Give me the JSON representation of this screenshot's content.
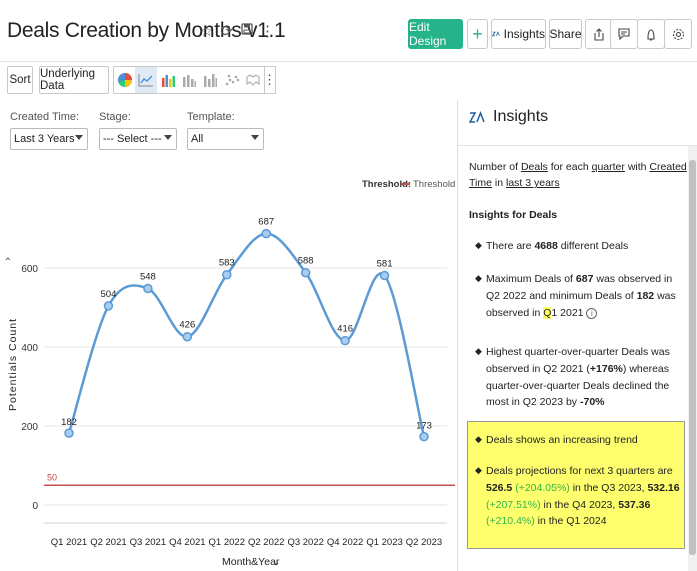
{
  "header": {
    "title": "Deals Creation by Months v1.1",
    "edit_design": "Edit Design",
    "plus": "+",
    "insights": "Insights",
    "share": "Share"
  },
  "toolbar": {
    "sort": "Sort",
    "underlying_data": "Underlying Data"
  },
  "filters": {
    "created_time_label": "Created Time:",
    "created_time_value": "Last 3 Years",
    "stage_label": "Stage:",
    "stage_value": "--- Select ---",
    "template_label": "Template:",
    "template_value": "All"
  },
  "colors": {
    "accent": "#25b38a",
    "series": "#5b9bd5",
    "threshold": "#c0504d",
    "highlight": "#ffff6e"
  },
  "chart_data": {
    "type": "line",
    "categories": [
      "Q1 2021",
      "Q2 2021",
      "Q3 2021",
      "Q4 2021",
      "Q1 2022",
      "Q2 2022",
      "Q3 2022",
      "Q4 2022",
      "Q1 2023",
      "Q2 2023"
    ],
    "values": [
      182,
      504,
      548,
      426,
      583,
      687,
      588,
      416,
      581,
      173
    ],
    "xlabel": "Month&Year",
    "ylabel": "Potentials Count",
    "ylim": [
      0,
      700
    ],
    "yticks": [
      0,
      200,
      400,
      600
    ],
    "threshold": 50,
    "threshold_label": "50",
    "legend_title": "Threshold:",
    "legend_item": "Threshold",
    "legend_position": "top-right",
    "grid": true,
    "smooth": true
  },
  "insights": {
    "title": "Insights",
    "summary_1": "Number of",
    "summary_deals": "Deals",
    "summary_2": "for each",
    "summary_quarter": "quarter",
    "summary_3": "with",
    "summary_created_time": "Created Time",
    "summary_4": "in",
    "summary_last3": "last 3 years",
    "section_title": "Insights for Deals",
    "b1_a": "There are",
    "b1_b": "4688",
    "b1_c": "different Deals",
    "b2_a": "Maximum",
    "b2_deals": "Deals",
    "b2_b": "of",
    "b2_c": "687",
    "b2_d": "was observed in Q2 2022 and minimum",
    "b2_deals2": "Deals",
    "b2_e": "of",
    "b2_f": "182",
    "b2_g": "was observed in",
    "b2_q": "Q",
    "b2_h": "1 2021",
    "b3_a": "Highest quarter-over-quarter Deals was observed in Q2 2021 (",
    "b3_b": "+176%",
    "b3_c": ") whereas quarter-over-quarter Deals declined the most in Q2 2023 by",
    "b3_d": "-70%",
    "b4": "Deals shows an increasing trend",
    "b5_a": "Deals projections for next 3 quarters are",
    "b5_v1": "526.5",
    "b5_p1": "(+204.05%)",
    "b5_b": "in the Q3 2023,",
    "b5_v2": "532.16",
    "b5_p2": "(+207.51%)",
    "b5_c": "in the Q4 2023,",
    "b5_v3": "537.36",
    "b5_p3": "(+210.4%)",
    "b5_d": "in the Q1 2024"
  }
}
